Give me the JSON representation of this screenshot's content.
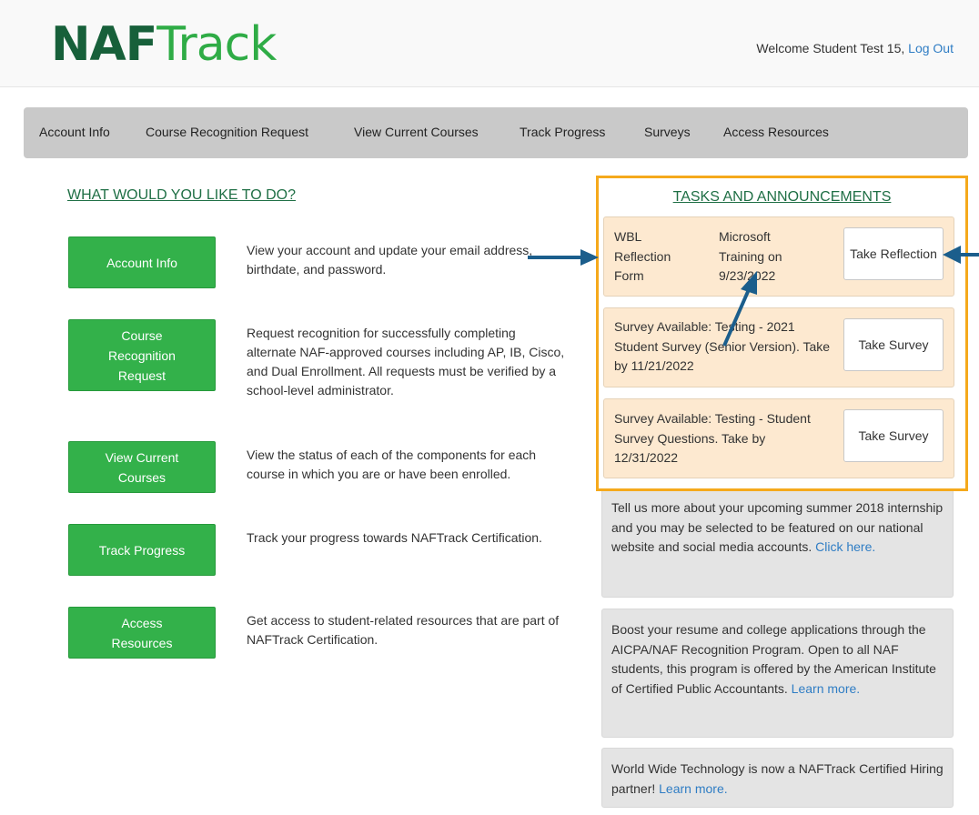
{
  "header": {
    "logo_part1": "NAF",
    "logo_part2": "Track",
    "welcome_text": "Welcome Student Test 15,",
    "logout_label": "Log Out"
  },
  "nav": {
    "items": [
      "Account Info",
      "Course Recognition Request",
      "View Current Courses",
      "Track Progress",
      "Surveys",
      "Access Resources"
    ]
  },
  "main": {
    "heading": "WHAT WOULD YOU LIKE TO DO?",
    "actions": [
      {
        "button": "Account Info",
        "description": "View your account and update your email address, birthdate, and password."
      },
      {
        "button": "Course Recognition Request",
        "description": "Request recognition for successfully completing alternate NAF-approved courses including AP, IB, Cisco, and Dual Enrollment. All requests must be verified by a school-level administrator."
      },
      {
        "button": "View Current Courses",
        "description": "View the status of each of the components for each course in which you are or have been enrolled."
      },
      {
        "button": "Track Progress",
        "description": "Track your progress towards NAFTrack Certification."
      },
      {
        "button": "Access Resources",
        "description": "Get access to student-related resources that are part of NAFTrack Certification."
      }
    ]
  },
  "tasks": {
    "heading": "TASKS AND ANNOUNCEMENTS",
    "items": [
      {
        "label": "WBL Reflection Form",
        "detail": "Microsoft Training on 9/23/2022",
        "button": "Take Reflection"
      },
      {
        "text": "Survey Available: Testing - 2021 Student Survey (Senior Version). Take by 11/21/2022",
        "button": "Take Survey"
      },
      {
        "text": "Survey Available: Testing - Student Survey Questions. Take by 12/31/2022",
        "button": "Take Survey"
      }
    ]
  },
  "announcements": [
    {
      "text": "Tell us more about your upcoming summer 2018 internship and you may be selected to be featured on our national website and social media accounts.",
      "link": "Click here."
    },
    {
      "text": "Boost your resume and college applications through the AICPA/NAF Recognition Program. Open to all NAF students, this program is offered by the American Institute of Certified Public Accountants.",
      "link": "Learn more."
    },
    {
      "text": "World Wide Technology is now a NAFTrack Certified Hiring partner!",
      "link": "Learn more."
    }
  ],
  "colors": {
    "brand_dark": "#17603a",
    "brand_green": "#2fac46",
    "button_green": "#33b14a",
    "highlight_orange": "#f5a91c",
    "task_bg": "#fde9d0",
    "link_blue": "#2f7dc4",
    "annotation_arrow": "#1b5e8c"
  }
}
